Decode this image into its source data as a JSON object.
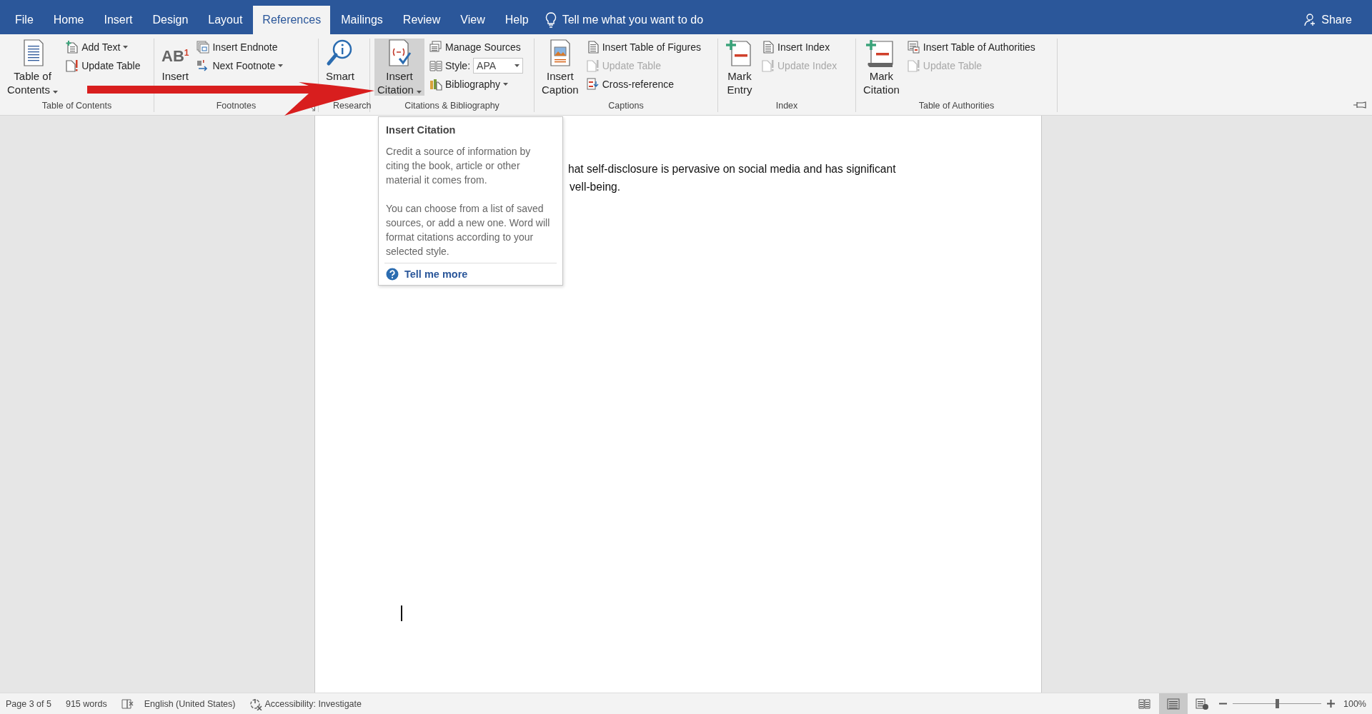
{
  "tabs": [
    {
      "label": "File",
      "selected": false
    },
    {
      "label": "Home",
      "selected": false
    },
    {
      "label": "Insert",
      "selected": false
    },
    {
      "label": "Design",
      "selected": false
    },
    {
      "label": "Layout",
      "selected": false
    },
    {
      "label": "References",
      "selected": true
    },
    {
      "label": "Mailings",
      "selected": false
    },
    {
      "label": "Review",
      "selected": false
    },
    {
      "label": "View",
      "selected": false
    },
    {
      "label": "Help",
      "selected": false
    }
  ],
  "tell_me": {
    "placeholder": "Tell me what you want to do"
  },
  "share_button": "Share",
  "ribbon": {
    "groups": [
      {
        "label": "Table of Contents",
        "items": [
          {
            "kind": "large",
            "lines": [
              "Table of",
              "Contents"
            ],
            "dropdown": true,
            "highlighted": false
          },
          {
            "kind": "small",
            "label": "Add Text",
            "dropdown": true,
            "disabled": false
          },
          {
            "kind": "small",
            "label": "Update Table",
            "disabled": false
          }
        ]
      },
      {
        "label": "Footnotes",
        "launcher": true,
        "items": [
          {
            "kind": "large",
            "lines": [
              "Insert"
            ],
            "icon_text": "AB",
            "icon_mark": "1",
            "highlighted": false
          },
          {
            "kind": "small",
            "label": "Insert Endnote",
            "disabled": false
          },
          {
            "kind": "small",
            "label": "Next Footnote",
            "dropdown": true,
            "disabled": false
          }
        ]
      },
      {
        "label": "Research",
        "items": [
          {
            "kind": "large",
            "lines": [
              "Smart"
            ],
            "highlighted": false
          }
        ]
      },
      {
        "label": "Citations & Bibliography",
        "items": [
          {
            "kind": "large",
            "lines": [
              "Insert",
              "Citation"
            ],
            "dropdown": true,
            "highlighted": true
          },
          {
            "kind": "small",
            "label": "Manage Sources",
            "disabled": false
          },
          {
            "kind": "combo",
            "label": "Style:",
            "value": "APA"
          },
          {
            "kind": "small",
            "label": "Bibliography",
            "dropdown": true,
            "disabled": false
          }
        ]
      },
      {
        "label": "Captions",
        "items": [
          {
            "kind": "large",
            "lines": [
              "Insert",
              "Caption"
            ],
            "highlighted": false
          },
          {
            "kind": "small",
            "label": "Insert Table of Figures",
            "disabled": false
          },
          {
            "kind": "small",
            "label": "Update Table",
            "disabled": true
          },
          {
            "kind": "small",
            "label": "Cross-reference",
            "disabled": false
          }
        ]
      },
      {
        "label": "Index",
        "items": [
          {
            "kind": "large",
            "lines": [
              "Mark",
              "Entry"
            ],
            "highlighted": false
          },
          {
            "kind": "small",
            "label": "Insert Index",
            "disabled": false
          },
          {
            "kind": "small",
            "label": "Update Index",
            "disabled": true
          }
        ]
      },
      {
        "label": "Table of Authorities",
        "items": [
          {
            "kind": "large",
            "lines": [
              "Mark",
              "Citation"
            ],
            "highlighted": false
          },
          {
            "kind": "small",
            "label": "Insert Table of Authorities",
            "disabled": false
          },
          {
            "kind": "small",
            "label": "Update Table",
            "disabled": true
          }
        ]
      }
    ]
  },
  "document": {
    "lines": [
      "hat self-disclosure is pervasive on social media and has significant",
      "vell-being."
    ]
  },
  "tooltip": {
    "title": "Insert Citation",
    "paragraphs": [
      "Credit a source of information by citing the book, article or other material it comes from.",
      "You can choose from a list of saved sources, or add a new one. Word will format citations according to your selected style."
    ],
    "link": "Tell me more"
  },
  "status_bar": {
    "page": "Page 3 of 5",
    "words": "915 words",
    "language": "English (United States)",
    "accessibility": "Accessibility: Investigate",
    "views": [
      {
        "selected": false
      },
      {
        "selected": true
      },
      {
        "selected": false
      }
    ],
    "zoom": {
      "level": 0.5,
      "reading": "100%"
    }
  }
}
